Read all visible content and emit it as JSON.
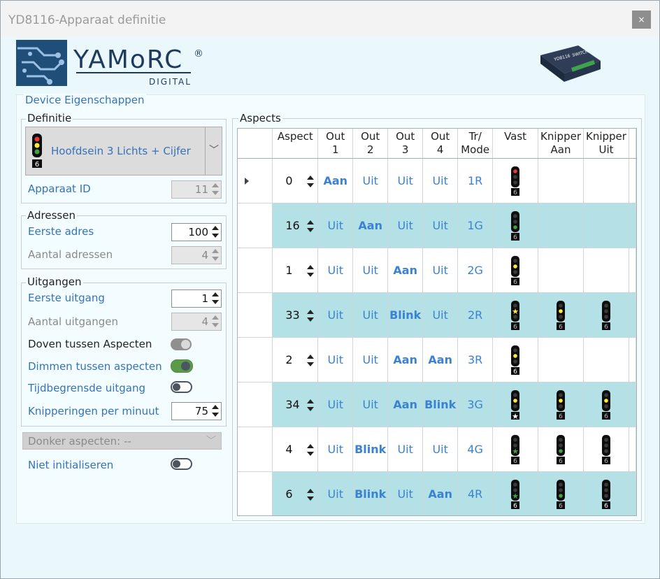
{
  "window": {
    "title": "YD8116-Apparaat definitie",
    "close_label": "×"
  },
  "logo": {
    "brand": "YAMoRC",
    "registered": "®",
    "sub": "DIGITAL"
  },
  "device_image": {
    "label1": "YD8116",
    "label2": "SWITCH"
  },
  "panel": {
    "title": "Device Eigenschappen"
  },
  "definitie": {
    "label": "Definitie",
    "selected": "Hoofdsein 3 Lichts + Cijfer",
    "sig_digit": "6",
    "apparaat_id_label": "Apparaat ID",
    "apparaat_id_value": "11"
  },
  "adressen": {
    "label": "Adressen",
    "eerste_adres_label": "Eerste adres",
    "eerste_adres_value": "100",
    "aantal_label": "Aantal adressen",
    "aantal_value": "4"
  },
  "uitgangen": {
    "label": "Uitgangen",
    "eerste_label": "Eerste uitgang",
    "eerste_value": "1",
    "aantal_label": "Aantal uitgangen",
    "aantal_value": "4",
    "doven_label": "Doven tussen Aspecten",
    "dimmen_label": "Dimmen tussen aspecten",
    "tijd_label": "Tijdbegrensde uitgang",
    "knipper_label": "Knipperingen per minuut",
    "knipper_value": "75"
  },
  "donker": {
    "label": "Donker aspecten: --"
  },
  "niet_init": {
    "label": "Niet initialiseren"
  },
  "aspects": {
    "label": "Aspects",
    "headers": {
      "aspect": "Aspect",
      "out1a": "Out",
      "out1b": "1",
      "out2a": "Out",
      "out2b": "2",
      "out3a": "Out",
      "out3b": "3",
      "out4a": "Out",
      "out4b": "4",
      "modea": "Tr/",
      "modeb": "Mode",
      "vast": "Vast",
      "kaana": "Knipper",
      "kaanb": "Aan",
      "kuita": "Knipper",
      "kuitb": "Uit"
    },
    "rows": [
      {
        "aspect": "0",
        "out1": "Aan",
        "out2": "Uit",
        "out3": "Uit",
        "out4": "Uit",
        "mode": "1R",
        "bold": [
          1
        ],
        "vast": {
          "lit": "red",
          "digit": "6"
        },
        "kaan": null,
        "kuit": null
      },
      {
        "aspect": "16",
        "out1": "Uit",
        "out2": "Aan",
        "out3": "Uit",
        "out4": "Uit",
        "mode": "1G",
        "bold": [
          2
        ],
        "vast": {
          "lit": "green",
          "digit": "6"
        },
        "kaan": null,
        "kuit": null
      },
      {
        "aspect": "1",
        "out1": "Uit",
        "out2": "Uit",
        "out3": "Aan",
        "out4": "Uit",
        "mode": "2G",
        "bold": [
          3
        ],
        "vast": {
          "lit": "yellow",
          "digit": "6"
        },
        "kaan": null,
        "kuit": null
      },
      {
        "aspect": "33",
        "out1": "Uit",
        "out2": "Uit",
        "out3": "Blink",
        "out4": "Uit",
        "mode": "2R",
        "bold": [
          3
        ],
        "vast": {
          "lit": "yellowstar",
          "digit": "6"
        },
        "kaan": {
          "lit": "yellow",
          "digit": "6"
        },
        "kuit": {
          "lit": "none",
          "digit": "6"
        }
      },
      {
        "aspect": "2",
        "out1": "Uit",
        "out2": "Uit",
        "out3": "Aan",
        "out4": "Aan",
        "mode": "3R",
        "bold": [
          3,
          4
        ],
        "vast": {
          "lit": "yellow",
          "digit": "6",
          "digitlit": true
        },
        "kaan": null,
        "kuit": null
      },
      {
        "aspect": "34",
        "out1": "Uit",
        "out2": "Uit",
        "out3": "Aan",
        "out4": "Blink",
        "mode": "3G",
        "bold": [
          3,
          4
        ],
        "vast": {
          "lit": "yellow",
          "digit": "star"
        },
        "kaan": {
          "lit": "yellow",
          "digit": "6"
        },
        "kuit": {
          "lit": "yellow",
          "digit": "6"
        }
      },
      {
        "aspect": "4",
        "out1": "Uit",
        "out2": "Blink",
        "out3": "Uit",
        "out4": "Uit",
        "mode": "4G",
        "bold": [
          2
        ],
        "vast": {
          "lit": "greenstar",
          "digit": "6"
        },
        "kaan": {
          "lit": "green",
          "digit": "6"
        },
        "kuit": {
          "lit": "none",
          "digit": "6"
        }
      },
      {
        "aspect": "6",
        "out1": "Uit",
        "out2": "Blink",
        "out3": "Uit",
        "out4": "Aan",
        "mode": "4R",
        "bold": [
          2,
          4
        ],
        "vast": {
          "lit": "greenstar",
          "digit": "6",
          "digitlit": true
        },
        "kaan": {
          "lit": "green",
          "digit": "6"
        },
        "kuit": {
          "lit": "none",
          "digit": "6",
          "digitlit": true
        }
      }
    ]
  },
  "colors": {
    "accent_blue": "#3572b8",
    "value_blue": "#3b82d4",
    "row_alt": "#b3e1e6",
    "toggle_on": "#5a9a49"
  }
}
